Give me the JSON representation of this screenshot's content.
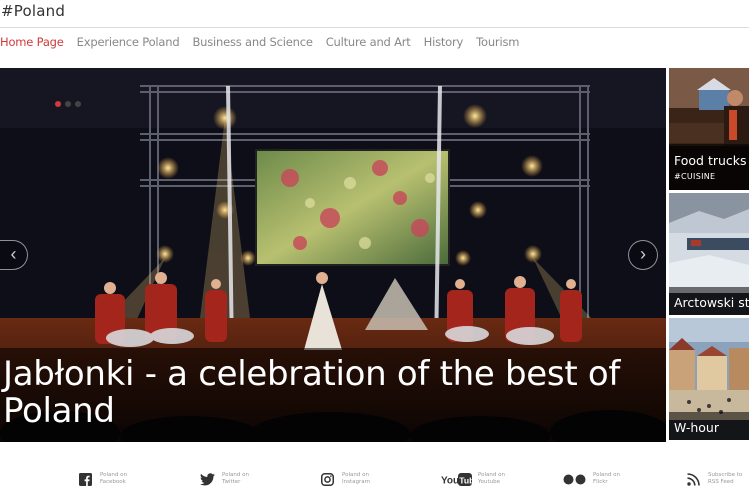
{
  "site": {
    "title": "#Poland"
  },
  "nav": {
    "items": [
      {
        "label": "Home Page"
      },
      {
        "label": "Experience Poland"
      },
      {
        "label": "Business and Science"
      },
      {
        "label": "Culture and Art"
      },
      {
        "label": "History"
      },
      {
        "label": "Tourism"
      }
    ]
  },
  "hero": {
    "title": "Jabłonki - a celebration of the best of Poland",
    "prev_arrow": "‹",
    "next_arrow": "›",
    "active_slide": 1,
    "slide_count": 3
  },
  "side": [
    {
      "title": "Food trucks i",
      "tag": "#CUISINE"
    },
    {
      "title": "Arctowski sta"
    },
    {
      "title": "W-hour"
    }
  ],
  "footer": {
    "social": [
      {
        "icon": "facebook-icon",
        "label_1": "Poland on",
        "label_2": "Facebook"
      },
      {
        "icon": "twitter-icon",
        "label_1": "Poland on",
        "label_2": "Twitter"
      },
      {
        "icon": "instagram-icon",
        "label_1": "Poland on",
        "label_2": "Instagram"
      },
      {
        "icon": "youtube-icon",
        "label_1": "Poland on",
        "label_2": "Youtube"
      },
      {
        "icon": "flickr-icon",
        "label_1": "Poland on",
        "label_2": "Flickr"
      },
      {
        "icon": "rss-icon",
        "label_1": "Subscribe to",
        "label_2": "RSS Feed"
      }
    ]
  },
  "colors": {
    "accent": "#d23a3a",
    "nav_text": "#888888",
    "footer_icon": "#333333"
  }
}
